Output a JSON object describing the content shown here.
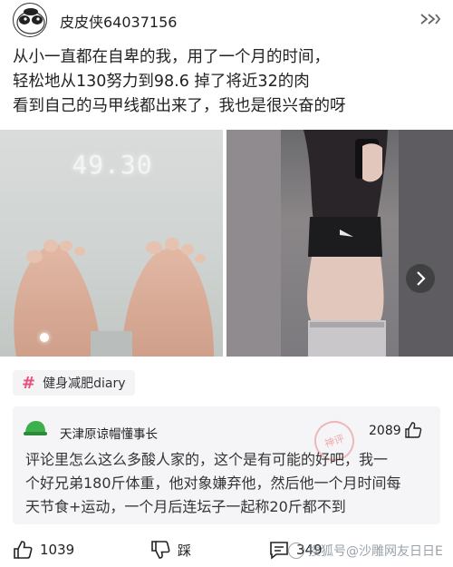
{
  "post": {
    "username": "皮皮侠64037156",
    "text_lines": [
      "从小一直都在自卑的我，用了一个月的时间，",
      "轻松地从130努力到98.6 掉了将近32的肉",
      "看到自己的马甲线都出来了，我也是很兴奋的呀"
    ],
    "images": [
      {
        "scale_reading": "49.30",
        "icon": "scale-photo"
      },
      {
        "icon": "mirror-selfie-photo"
      }
    ],
    "tag": {
      "hash": "#",
      "label": "健身减肥diary"
    }
  },
  "comment": {
    "username": "天津原谅帽懂事长",
    "likes": "2089",
    "stamp": "神评",
    "text_lines": [
      "评论里怎么这么多酸人家的，这个是有可能的好吧，我一",
      "个好兄弟180斤体重，他对象嫌弃他，然后他一个月时间每",
      "天节食+运动，一个月后连坛子一起称20斤都不到"
    ]
  },
  "actions": {
    "like_count": "1039",
    "dislike_label": "踩",
    "comment_count": "349"
  },
  "watermark": {
    "text": "搜狐号@沙雕网友日日E"
  },
  "colors": {
    "tag_hash": "#e8507a",
    "comment_bg": "#f5f5f7",
    "avatar_green": "#3cb04a"
  }
}
